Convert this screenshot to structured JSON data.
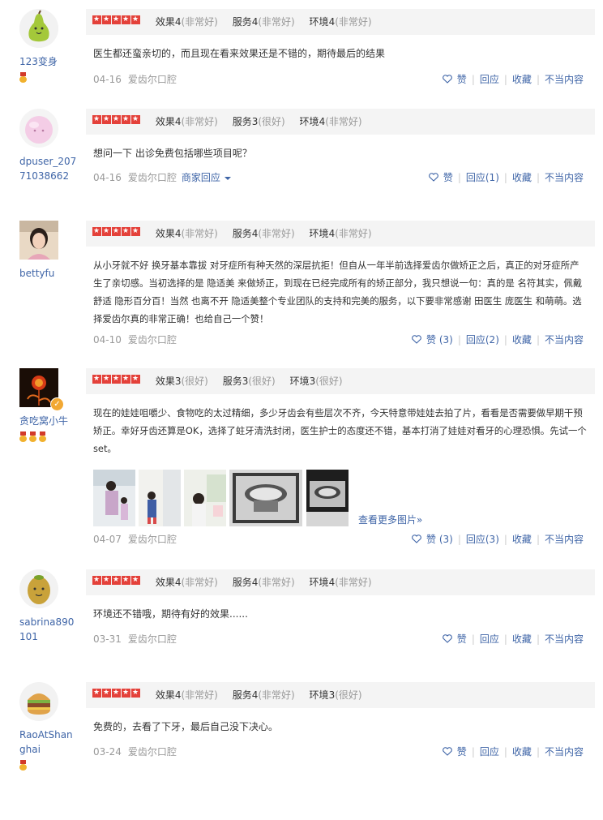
{
  "common": {
    "service_label": "爱齿尔口腔",
    "like_label": "赞",
    "reply_label": "回应",
    "favorite_label": "收藏",
    "report_label": "不当内容",
    "more_photos_label": "查看更多图片»"
  },
  "reviews": [
    {
      "user": "123变身",
      "stars": 5,
      "ratings": [
        {
          "label": "效果",
          "score": "4",
          "desc": "(非常好)"
        },
        {
          "label": "服务",
          "score": "4",
          "desc": "(非常好)"
        },
        {
          "label": "环境",
          "score": "4",
          "desc": "(非常好)"
        }
      ],
      "text": "医生都还蛮亲切的，而且现在看来效果还是不错的，期待最后的结果",
      "date": "04-16",
      "like": "赞",
      "reply": "回应"
    },
    {
      "user": "dpuser_20771038662",
      "stars": 5,
      "ratings": [
        {
          "label": "效果",
          "score": "4",
          "desc": "(非常好)"
        },
        {
          "label": "服务",
          "score": "3",
          "desc": "(很好)"
        },
        {
          "label": "环境",
          "score": "4",
          "desc": "(非常好)"
        }
      ],
      "text": "想问一下 出诊免费包括哪些项目呢？",
      "date": "04-16",
      "merchant_reply": "商家回应",
      "like": "赞",
      "reply": "回应(1)"
    },
    {
      "user": "bettyfu",
      "stars": 5,
      "ratings": [
        {
          "label": "效果",
          "score": "4",
          "desc": "(非常好)"
        },
        {
          "label": "服务",
          "score": "4",
          "desc": "(非常好)"
        },
        {
          "label": "环境",
          "score": "4",
          "desc": "(非常好)"
        }
      ],
      "text": "从小牙就不好 换牙基本靠拔 对牙症所有种天然的深层抗拒！但自从一年半前选择爱齿尔做矫正之后，真正的对牙症所产生了亲切感。当初选择的是 隐适美 来做矫正，到现在已经完成所有的矫正部分，我只想说一句：真的是 名符其实，佩戴舒适 隐形百分百！当然 也离不开 隐适美整个专业团队的支持和完美的服务，以下要非常感谢 田医生 庞医生 和萌萌。选择爱齿尔真的非常正确！也给自己一个赞！",
      "date": "04-10",
      "like": "赞 (3)",
      "reply": "回应(2)"
    },
    {
      "user": "贪吃窝小牛",
      "stars": 5,
      "ratings": [
        {
          "label": "效果",
          "score": "3",
          "desc": "(很好)"
        },
        {
          "label": "服务",
          "score": "3",
          "desc": "(很好)"
        },
        {
          "label": "环境",
          "score": "3",
          "desc": "(很好)"
        }
      ],
      "text": "现在的娃娃咀嚼少、食物吃的太过精细，多少牙齿会有些层次不齐，今天特意带娃娃去拍了片，看看是否需要做早期干预矫正。幸好牙齿还算是OK，选择了蛀牙清洗封闭，医生护士的态度还不错，基本打消了娃娃对看牙的心理恐惧。先试一个set。",
      "date": "04-07",
      "like": "赞 (3)",
      "reply": "回应(3)"
    },
    {
      "user": "sabrina890101",
      "stars": 5,
      "ratings": [
        {
          "label": "效果",
          "score": "4",
          "desc": "(非常好)"
        },
        {
          "label": "服务",
          "score": "4",
          "desc": "(非常好)"
        },
        {
          "label": "环境",
          "score": "4",
          "desc": "(非常好)"
        }
      ],
      "text": "环境还不错哦，期待有好的效果......",
      "date": "03-31",
      "like": "赞",
      "reply": "回应"
    },
    {
      "user": "RaoAtShanghai",
      "stars": 5,
      "ratings": [
        {
          "label": "效果",
          "score": "4",
          "desc": "(非常好)"
        },
        {
          "label": "服务",
          "score": "4",
          "desc": "(非常好)"
        },
        {
          "label": "环境",
          "score": "3",
          "desc": "(很好)"
        }
      ],
      "text": "免费的，去看了下牙，最后自己没下决心。",
      "date": "03-24",
      "like": "赞",
      "reply": "回应"
    }
  ]
}
